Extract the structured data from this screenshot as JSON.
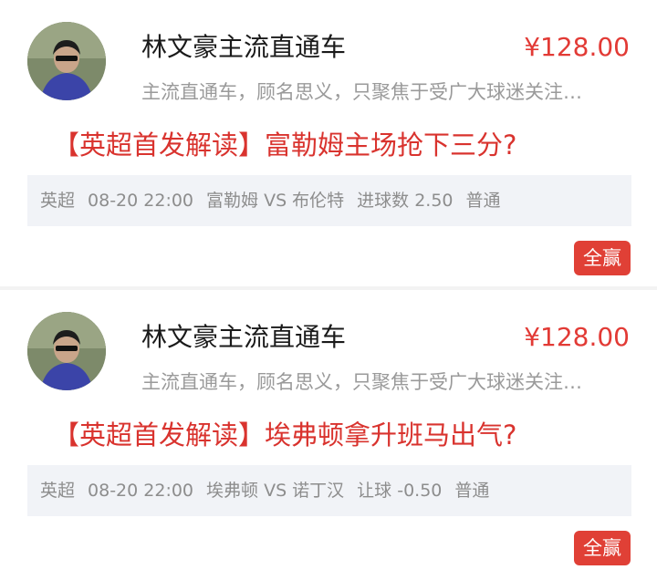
{
  "cards": [
    {
      "author": "林文豪主流直通车",
      "price": "¥128.00",
      "description": "主流直通车，顾名思义，只聚焦于受广大球迷关注…",
      "headline": "【英超首发解读】富勒姆主场抢下三分?",
      "meta": {
        "league": "英超",
        "datetime": "08-20 22:00",
        "match": "富勒姆 VS 布伦特",
        "market": "进球数 2.50",
        "level": "普通"
      },
      "result": "全赢",
      "avatar_icon": "author-avatar-photo"
    },
    {
      "author": "林文豪主流直通车",
      "price": "¥128.00",
      "description": "主流直通车，顾名思义，只聚焦于受广大球迷关注…",
      "headline": "【英超首发解读】埃弗顿拿升班马出气?",
      "meta": {
        "league": "英超",
        "datetime": "08-20 22:00",
        "match": "埃弗顿 VS 诺丁汉",
        "market": "让球 -0.50",
        "level": "普通"
      },
      "result": "全赢",
      "avatar_icon": "author-avatar-photo"
    }
  ],
  "colors": {
    "accent": "#e23a35",
    "result_badge": "#e04036",
    "meta_bg": "#f1f3f7",
    "page_bg": "#f3f3f3"
  }
}
